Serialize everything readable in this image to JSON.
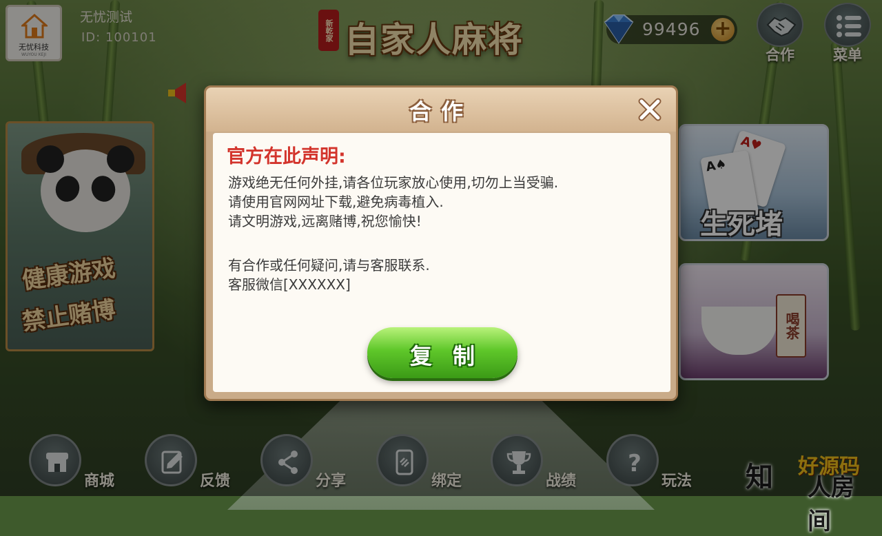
{
  "user": {
    "nickname": "无忧测试",
    "id_text": "ID: 100101",
    "avatar_caption": "无忧科技",
    "avatar_sub": "WUYOU KEJI"
  },
  "logo": {
    "seal": "新乾家",
    "title": "自家人麻将"
  },
  "currency": {
    "icon": "diamond-icon",
    "value": "99496",
    "plus_label": "+"
  },
  "top_buttons": [
    {
      "label": "合作",
      "icon": "handshake-icon"
    },
    {
      "label": "菜单",
      "icon": "menu-icon"
    }
  ],
  "left_card": {
    "line1": "健康游戏",
    "line2": "禁止赌博"
  },
  "right_cards": [
    {
      "label": "生死堵"
    },
    {
      "label": "喝茶"
    }
  ],
  "bottom_menu": [
    {
      "label": "商城",
      "icon": "shop-icon"
    },
    {
      "label": "反馈",
      "icon": "feedback-icon"
    },
    {
      "label": "分享",
      "icon": "share-icon"
    },
    {
      "label": "绑定",
      "icon": "bind-icon"
    },
    {
      "label": "战绩",
      "icon": "trophy-icon"
    },
    {
      "label": "玩法",
      "icon": "question-icon"
    }
  ],
  "watermark": {
    "a": "知",
    "b": "好源码",
    "c": "人房间"
  },
  "dialog": {
    "title": "合作",
    "heading": "官方在此声明:",
    "lines": [
      "游戏绝无任何外挂,请各位玩家放心使用,切勿上当受骗.",
      "请使用官网网址下载,避免病毒植入.",
      "请文明游戏,远离赌博,祝您愉快!",
      "有合作或任何疑问,请与客服联系.",
      "客服微信[XXXXXX]"
    ],
    "copy_label": "复制"
  }
}
